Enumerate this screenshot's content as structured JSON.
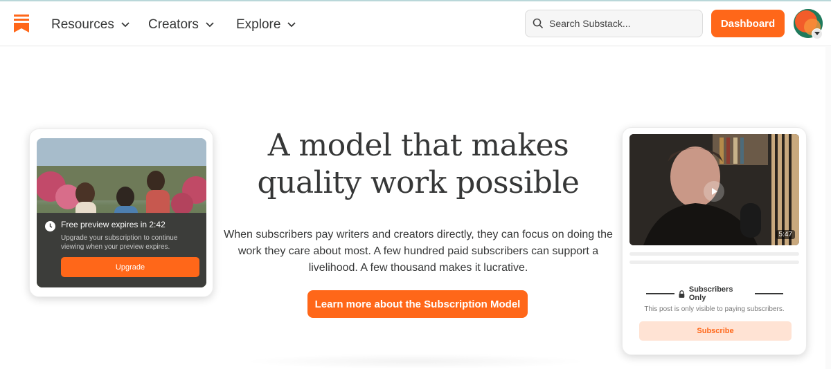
{
  "colors": {
    "brand": "#ff6719",
    "text": "#363737",
    "subscribe_bg": "#ffe3d4"
  },
  "nav": {
    "logo_icon": "substack-logo-icon",
    "items": [
      {
        "label": "Resources"
      },
      {
        "label": "Creators"
      },
      {
        "label": "Explore"
      }
    ],
    "search": {
      "placeholder": "Search Substack...",
      "value": ""
    },
    "dashboard_label": "Dashboard"
  },
  "hero": {
    "title": "A model that makes quality work possible",
    "body": "When subscribers pay writers and creators directly, they can focus on doing the work they care about most. A few hundred paid subscribers can support a livelihood. A few thousand makes it lucrative.",
    "cta_label": "Learn more about the Subscription Model"
  },
  "card_left": {
    "preview_title": "Free preview expires in 2:42",
    "preview_subtitle": "Upgrade your subscription to continue viewing when your preview expires.",
    "upgrade_label": "Upgrade"
  },
  "card_right": {
    "duration": "5:47",
    "subscribers_only": "Subscribers Only",
    "visible_note": "This post is only visible to paying subscribers.",
    "subscribe_label": "Subscribe"
  }
}
